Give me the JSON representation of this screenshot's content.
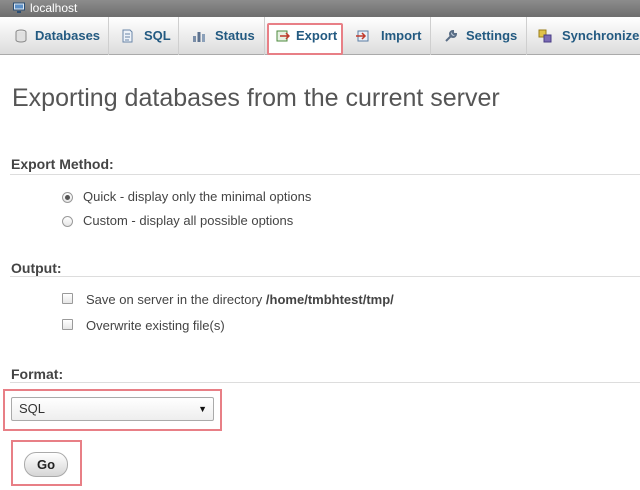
{
  "server": {
    "name": "localhost"
  },
  "tabs": [
    {
      "label": "Databases",
      "icon": "database-icon"
    },
    {
      "label": "SQL",
      "icon": "sql-icon"
    },
    {
      "label": "Status",
      "icon": "status-icon"
    },
    {
      "label": "Export",
      "icon": "export-icon",
      "active": true
    },
    {
      "label": "Import",
      "icon": "import-icon"
    },
    {
      "label": "Settings",
      "icon": "wrench-icon"
    },
    {
      "label": "Synchronize",
      "icon": "synchronize-icon"
    }
  ],
  "page": {
    "title": "Exporting databases from the current server"
  },
  "export_method": {
    "heading": "Export Method:",
    "options": [
      {
        "label": "Quick - display only the minimal options",
        "checked": true
      },
      {
        "label": "Custom - display all possible options",
        "checked": false
      }
    ]
  },
  "output": {
    "heading": "Output:",
    "save_on_server_prefix": "Save on server in the directory ",
    "save_on_server_path": "/home/tmbhtest/tmp/",
    "overwrite_label": "Overwrite existing file(s)"
  },
  "format": {
    "heading": "Format:",
    "selected": "SQL"
  },
  "go_label": "Go",
  "colors": {
    "tab_text": "#235a81",
    "highlight_border": "#e87f86",
    "server_bar": "#7a7a7a"
  }
}
